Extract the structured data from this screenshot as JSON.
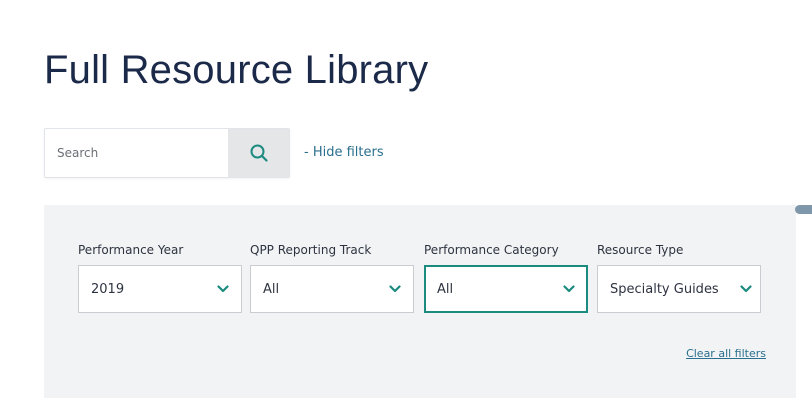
{
  "page": {
    "title": "Full Resource Library"
  },
  "search": {
    "placeholder": "Search",
    "value": "",
    "button_icon": "search-icon"
  },
  "toggle_filters_label": "- Hide filters",
  "filters": [
    {
      "label": "Performance Year",
      "value": "2019",
      "focused": false
    },
    {
      "label": "QPP Reporting Track",
      "value": "All",
      "focused": false
    },
    {
      "label": "Performance Category",
      "value": "All",
      "focused": true
    },
    {
      "label": "Resource Type",
      "value": "Specialty Guides",
      "focused": false
    }
  ],
  "clear_all_label": "Clear all filters",
  "colors": {
    "accent_teal": "#1b8a7f",
    "link": "#2a6f8f",
    "panel_bg": "#f2f3f4",
    "title": "#1c2a4a"
  }
}
